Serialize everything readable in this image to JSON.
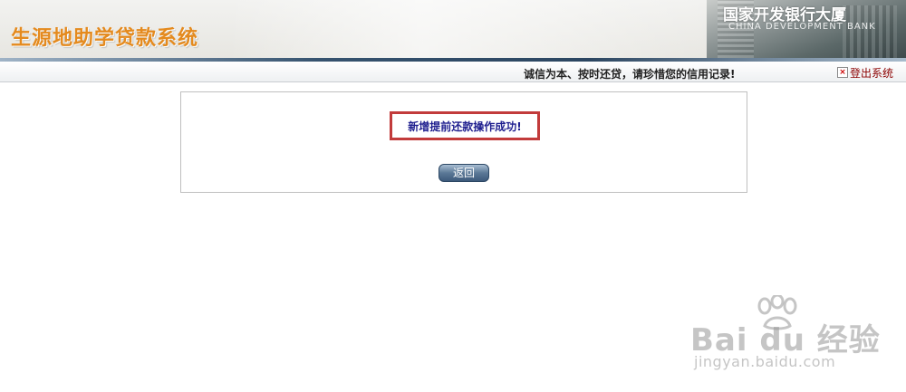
{
  "header": {
    "app_title": "生源地助学贷款系统",
    "building_sign": "国家开发银行大厦",
    "building_sign_en": "CHINA DEVELOPMENT BANK"
  },
  "status_bar": {
    "slogan": "诚信为本、按时还贷，请珍惜您的信用记录!",
    "logout_label": "登出系统",
    "logout_icon": "×"
  },
  "message": {
    "text": "新增提前还款操作成功!"
  },
  "actions": {
    "back_label": "返回"
  },
  "watermark": {
    "logo_text": "Bai du 经验",
    "url": "jingyan.baidu.com"
  },
  "colors": {
    "title_orange": "#e48a1e",
    "message_text": "#1f1f8f",
    "highlight_border": "#c23b3b",
    "logout_text": "#8b0000",
    "button_blue": "#3d5a7b"
  }
}
